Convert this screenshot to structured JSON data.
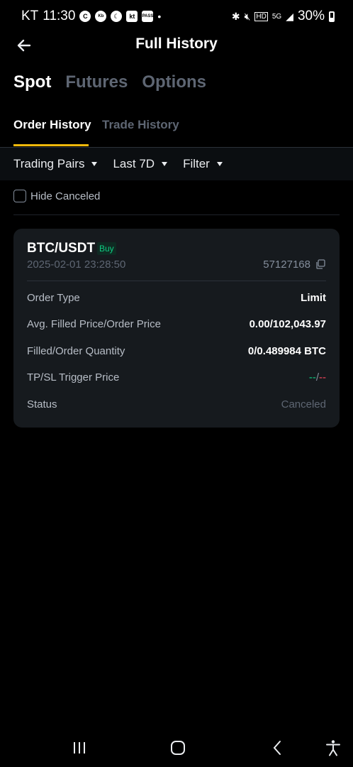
{
  "status_bar": {
    "carrier": "KT",
    "time": "11:30",
    "app_icons": [
      "C",
      "Kbank",
      "moon",
      "kt",
      "PASS"
    ],
    "dot": "•",
    "battery": "30%"
  },
  "header": {
    "title": "Full History",
    "back_icon": "arrow-left-icon"
  },
  "main_tabs": [
    {
      "label": "Spot",
      "active": true
    },
    {
      "label": "Futures",
      "active": false
    },
    {
      "label": "Options",
      "active": false
    }
  ],
  "sub_tabs": [
    {
      "label": "Order History",
      "active": true
    },
    {
      "label": "Trade History",
      "active": false
    }
  ],
  "filters": {
    "trading_pairs": "Trading Pairs",
    "period": "Last 7D",
    "filter": "Filter"
  },
  "hide_canceled": {
    "label": "Hide Canceled",
    "checked": false
  },
  "order": {
    "pair": "BTC/USDT",
    "side": "Buy",
    "time": "2025-02-01 23:28:50",
    "id": "57127168",
    "rows": [
      {
        "label": "Order Type",
        "value": "Limit"
      },
      {
        "label": "Avg. Filled Price/Order Price",
        "value": "0.00/102,043.97"
      },
      {
        "label": "Filled/Order Quantity",
        "value": "0/0.489984 BTC"
      },
      {
        "label": "TP/SL Trigger Price",
        "tp": "--",
        "sep": "/",
        "sl": "--"
      },
      {
        "label": "Status",
        "value": "Canceled"
      }
    ]
  },
  "colors": {
    "accent": "#f0b90b",
    "buy": "#0ecb81",
    "sell": "#f6465d",
    "card": "#161a1e"
  }
}
